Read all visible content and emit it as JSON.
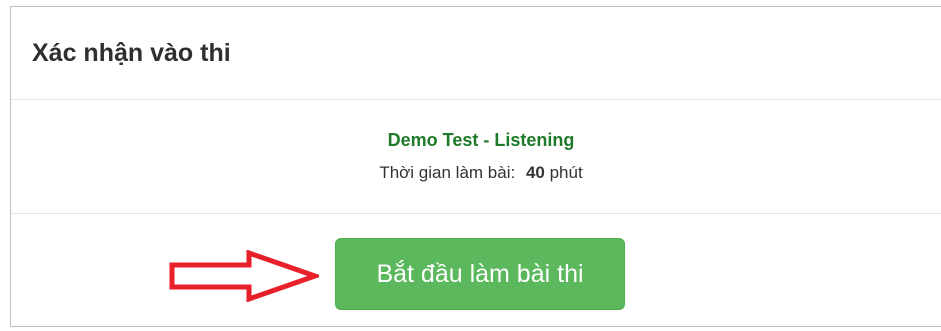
{
  "modal": {
    "title": "Xác nhận vào thi",
    "test_name": "Demo Test - Listening",
    "duration_label": "Thời gian làm bài:",
    "duration_value": "40",
    "duration_unit": "phút",
    "start_button_label": "Bắt đầu làm bài thi"
  },
  "annotation": {
    "arrow_icon": "right-arrow-icon",
    "arrow_color": "#e8202a"
  },
  "colors": {
    "button_bg": "#5cb85c",
    "test_name": "#1f7a2a"
  }
}
